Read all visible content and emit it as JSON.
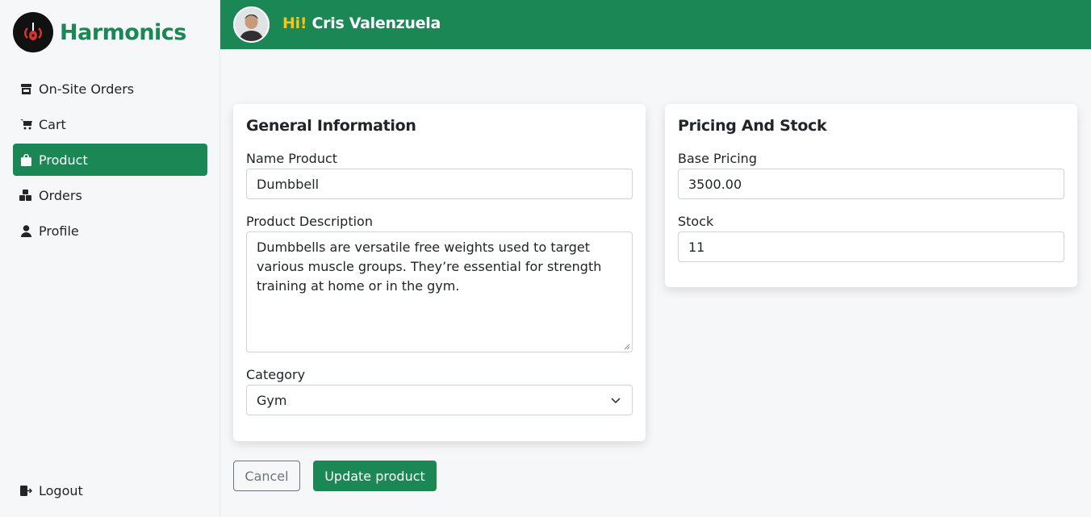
{
  "brand": {
    "name": "Harmonics",
    "logo_icon": "guitar-logo-icon"
  },
  "sidebar": {
    "items": [
      {
        "label": "On-Site Orders",
        "icon": "store-icon"
      },
      {
        "label": "Cart",
        "icon": "cart-icon"
      },
      {
        "label": "Product",
        "icon": "bag-icon",
        "active": true
      },
      {
        "label": "Orders",
        "icon": "boxes-icon"
      },
      {
        "label": "Profile",
        "icon": "person-icon"
      }
    ],
    "logout": {
      "label": "Logout",
      "icon": "logout-icon"
    }
  },
  "header": {
    "greeting": "Hi!",
    "user_name": "Cris Valenzuela"
  },
  "general": {
    "title": "General Information",
    "name_label": "Name Product",
    "name_value": "Dumbbell",
    "description_label": "Product Description",
    "description_value": "Dumbbells are versatile free weights used to target various muscle groups. They’re essential for strength training at home or in the gym.",
    "category_label": "Category",
    "category_value": "Gym"
  },
  "pricing": {
    "title": "Pricing And Stock",
    "base_label": "Base Pricing",
    "base_value": "3500.00",
    "stock_label": "Stock",
    "stock_value": "11"
  },
  "actions": {
    "cancel_label": "Cancel",
    "update_label": "Update product"
  },
  "colors": {
    "brand": "#1a8754",
    "accent": "#f5c518"
  }
}
